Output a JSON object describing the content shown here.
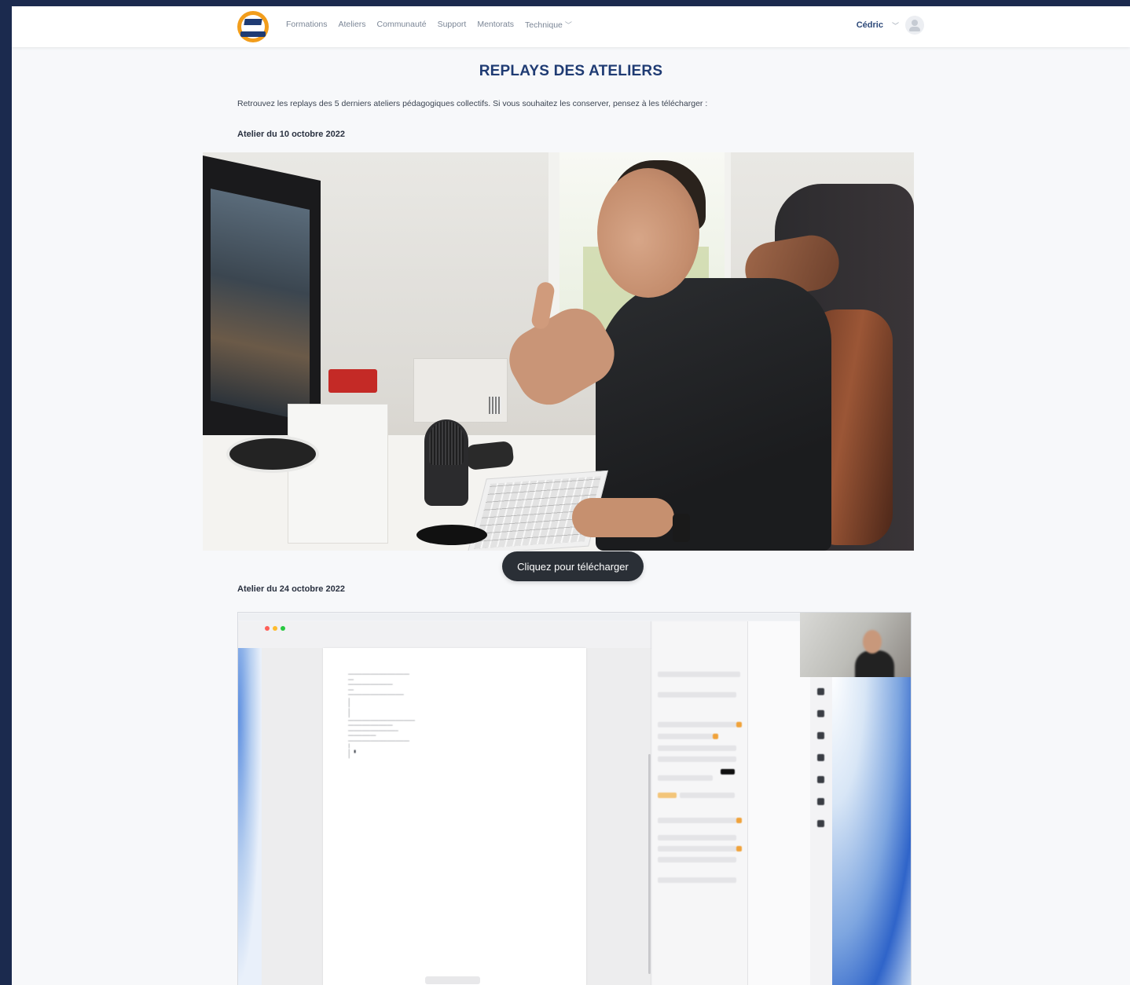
{
  "nav": {
    "items": [
      "Formations",
      "Ateliers",
      "Communauté",
      "Support",
      "Mentorats",
      "Technique"
    ],
    "user_name": "Cédric"
  },
  "page": {
    "title": "REPLAYS DES ATELIERS",
    "intro": "Retrouvez les replays des 5 derniers ateliers pédagogiques collectifs. Si vous souhaitez les conserver, pensez à les télécharger :"
  },
  "ateliers": [
    {
      "heading": "Atelier du 10 octobre 2022",
      "download_label": "Cliquez pour télécharger"
    },
    {
      "heading": "Atelier du 24 octobre 2022"
    }
  ],
  "colors": {
    "accent": "#1f3b73",
    "frame_bg": "#1b2a4e",
    "button_bg": "#2a2f36"
  }
}
